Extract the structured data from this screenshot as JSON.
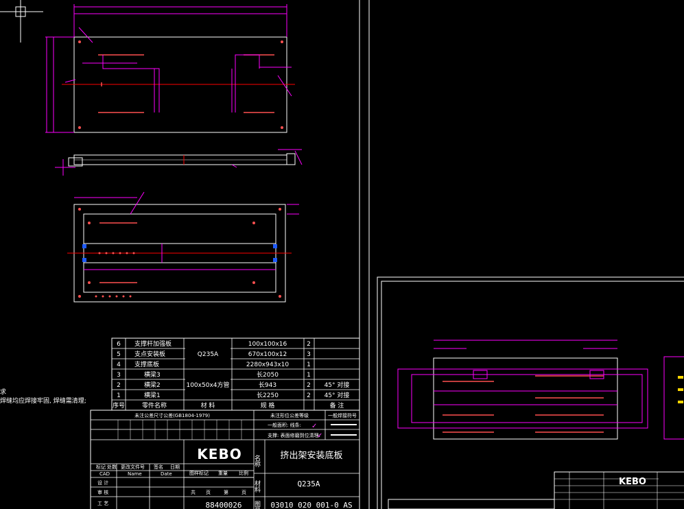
{
  "colors": {
    "background": "#000000",
    "outline": "#ffffff",
    "dimension": "#ff00ff",
    "center_line": "#ff0000",
    "hole": "#ff5050",
    "marker": "#1e5aff",
    "check": "#ff40ff"
  },
  "parts_list": {
    "rows": [
      {
        "no": "6",
        "name": "支撑杆加强板",
        "material": "",
        "spec": "100x100x16",
        "qty": "2",
        "remark": ""
      },
      {
        "no": "5",
        "name": "支点安装板",
        "material": "Q235A",
        "spec": "670x100x12",
        "qty": "3",
        "remark": ""
      },
      {
        "no": "4",
        "name": "支撑底板",
        "material": "",
        "spec": "2280x943x10",
        "qty": "1",
        "remark": ""
      },
      {
        "no": "3",
        "name": "横梁3",
        "material": "",
        "spec": "长2050",
        "qty": "1",
        "remark": ""
      },
      {
        "no": "2",
        "name": "横梁2",
        "material": "100x50x4方管",
        "spec": "长943",
        "qty": "2",
        "remark": "45° 对接"
      },
      {
        "no": "1",
        "name": "横梁1",
        "material": "",
        "spec": "长2250",
        "qty": "2",
        "remark": "45° 对接"
      }
    ],
    "header": {
      "no": "序号",
      "name": "零件名称",
      "material": "材 料",
      "spec": "规 格",
      "qty": "",
      "remark": "备 注"
    }
  },
  "title_block": {
    "logo": "KEBO",
    "drawing_name": "挤出架安装底板",
    "name_label": "名称",
    "material_label": "材料",
    "material": "Q235A",
    "drawing_no_label": "图号",
    "drawing_no": "03010 020 001-0 AS",
    "code": "88400026",
    "tolerance_title": "未注公差尺寸公差(GB1804-1979)",
    "roughness_title": "未注形位公差等级",
    "weld_title": "一般焊接符号",
    "fixed_labels": [
      "标记",
      "处数",
      "更改文件号",
      "签名",
      "日期"
    ],
    "cad_labels": [
      "CAD",
      "Name",
      "Date"
    ],
    "role_labels": [
      "设 计",
      "审 核",
      "工 艺"
    ],
    "stage_labels": [
      "图样标记",
      "重量",
      "比例"
    ],
    "sheet_labels": [
      "共",
      "页",
      "第",
      "页"
    ],
    "weld_note_1": "一般面积: 线条:",
    "weld_note_2": "支撑: 表面修磨到位清理:"
  },
  "notes": {
    "line1": "求",
    "line2": "焊缝均应焊接牢固, 焊缝需清理;"
  }
}
